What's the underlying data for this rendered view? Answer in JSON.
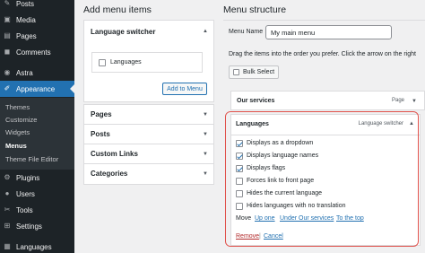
{
  "sidebar": {
    "items": [
      {
        "label": "Posts",
        "icon": "pin-icon",
        "glyph": "✎"
      },
      {
        "label": "Media",
        "icon": "media-icon",
        "glyph": "▣"
      },
      {
        "label": "Pages",
        "icon": "page-icon",
        "glyph": "▤"
      },
      {
        "label": "Comments",
        "icon": "comment-icon",
        "glyph": "◼"
      },
      {
        "label": "Astra",
        "icon": "astra-icon",
        "glyph": "◉"
      },
      {
        "label": "Appearance",
        "icon": "brush-icon",
        "glyph": "✐"
      },
      {
        "label": "Plugins",
        "icon": "plugin-icon",
        "glyph": "⚙"
      },
      {
        "label": "Users",
        "icon": "user-icon",
        "glyph": "●"
      },
      {
        "label": "Tools",
        "icon": "wrench-icon",
        "glyph": "✂"
      },
      {
        "label": "Settings",
        "icon": "settings-icon",
        "glyph": "⊞"
      },
      {
        "label": "Languages",
        "icon": "languages-icon",
        "glyph": "▦"
      }
    ],
    "submenu": [
      "Themes",
      "Customize",
      "Widgets",
      "Menus",
      "Theme File Editor"
    ]
  },
  "add_menu_items": {
    "heading": "Add menu items",
    "language_switcher": {
      "title": "Language switcher",
      "option": "Languages",
      "button": "Add to Menu"
    },
    "sections": [
      "Pages",
      "Posts",
      "Custom Links",
      "Categories"
    ]
  },
  "menu_structure": {
    "heading": "Menu structure",
    "menu_name_label": "Menu Name",
    "menu_name_value": "My main menu",
    "instructions": "Drag the items into the order you prefer. Click the arrow on the right",
    "bulk_select": "Bulk Select",
    "items": [
      {
        "title": "Our services",
        "type": "Page"
      }
    ],
    "languages_item": {
      "title": "Languages",
      "type": "Language switcher",
      "options": [
        {
          "label": "Displays as a dropdown",
          "checked": true
        },
        {
          "label": "Displays language names",
          "checked": true
        },
        {
          "label": "Displays flags",
          "checked": true
        },
        {
          "label": "Forces link to front page",
          "checked": false
        },
        {
          "label": "Hides the current language",
          "checked": false
        },
        {
          "label": "Hides languages with no translation",
          "checked": false
        }
      ],
      "move_label": "Move",
      "move_links": [
        "Up one",
        "Under Our services",
        "To the top"
      ],
      "remove": "Remove",
      "separator": "|",
      "cancel": "Cancel"
    }
  },
  "colors": {
    "accent": "#2271b1",
    "sidebar": "#1d2327",
    "highlight": "#e0524c",
    "delete": "#b32d2e"
  }
}
